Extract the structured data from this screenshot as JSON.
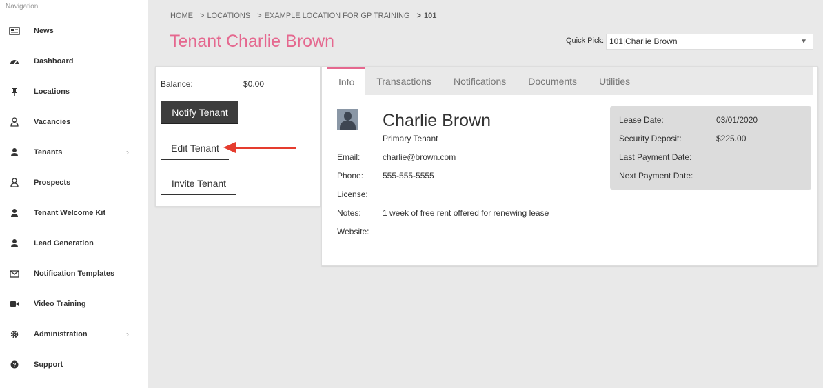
{
  "sidebar": {
    "title": "Navigation",
    "items": [
      {
        "label": "News",
        "icon": "newspaper-icon",
        "has_submenu": false
      },
      {
        "label": "Dashboard",
        "icon": "dashboard-icon",
        "has_submenu": false
      },
      {
        "label": "Locations",
        "icon": "pin-icon",
        "has_submenu": false
      },
      {
        "label": "Vacancies",
        "icon": "user-outline-icon",
        "has_submenu": false
      },
      {
        "label": "Tenants",
        "icon": "user-icon",
        "has_submenu": true
      },
      {
        "label": "Prospects",
        "icon": "user-outline-icon",
        "has_submenu": false
      },
      {
        "label": "Tenant Welcome Kit",
        "icon": "user-icon",
        "has_submenu": false
      },
      {
        "label": "Lead Generation",
        "icon": "user-icon",
        "has_submenu": false
      },
      {
        "label": "Notification Templates",
        "icon": "envelope-icon",
        "has_submenu": false
      },
      {
        "label": "Video Training",
        "icon": "video-camera-icon",
        "has_submenu": false
      },
      {
        "label": "Administration",
        "icon": "gear-icon",
        "has_submenu": true
      },
      {
        "label": "Support",
        "icon": "question-circle-icon",
        "has_submenu": false
      }
    ],
    "chevron": "›"
  },
  "breadcrumb": {
    "items": [
      "HOME",
      "LOCATIONS",
      "EXAMPLE LOCATION FOR GP TRAINING",
      "101"
    ],
    "separator": ">"
  },
  "page_title": "Tenant Charlie Brown",
  "quick_pick": {
    "label": "Quick Pick:",
    "value": "101|Charlie Brown",
    "arrow": "▼"
  },
  "actions": {
    "balance_label": "Balance:",
    "balance_value": "$0.00",
    "notify": "Notify Tenant",
    "edit": "Edit Tenant",
    "invite": "Invite Tenant"
  },
  "tabs": [
    {
      "label": "Info",
      "active": true
    },
    {
      "label": "Transactions",
      "active": false
    },
    {
      "label": "Notifications",
      "active": false
    },
    {
      "label": "Documents",
      "active": false
    },
    {
      "label": "Utilities",
      "active": false
    }
  ],
  "tenant": {
    "name": "Charlie Brown",
    "role": "Primary Tenant",
    "fields": [
      {
        "label": "Email:",
        "value": "charlie@brown.com"
      },
      {
        "label": "Phone:",
        "value": "555-555-5555"
      },
      {
        "label": "License:",
        "value": ""
      },
      {
        "label": "Notes:",
        "value": "1 week of free rent offered for renewing lease"
      },
      {
        "label": "Website:",
        "value": ""
      }
    ]
  },
  "lease": [
    {
      "label": "Lease Date:",
      "value": "03/01/2020"
    },
    {
      "label": "Security Deposit:",
      "value": "$225.00"
    },
    {
      "label": "Last Payment Date:",
      "value": ""
    },
    {
      "label": "Next Payment Date:",
      "value": ""
    }
  ],
  "colors": {
    "accent": "#e5688f",
    "annotation_arrow": "#e53c2e"
  }
}
